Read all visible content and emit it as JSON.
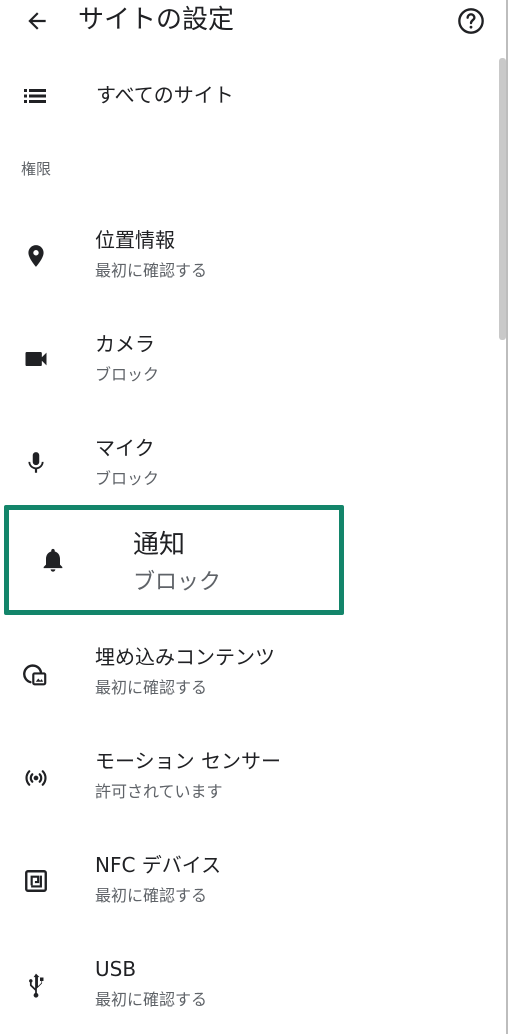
{
  "header": {
    "title": "サイトの設定",
    "back_icon": "arrow-back-icon",
    "help_icon": "help-circle-icon"
  },
  "all_sites": {
    "label": "すべてのサイト",
    "icon": "list-icon"
  },
  "section": {
    "label": "権限"
  },
  "items": [
    {
      "title": "位置情報",
      "subtitle": "最初に確認する",
      "icon": "location-pin-icon"
    },
    {
      "title": "カメラ",
      "subtitle": "ブロック",
      "icon": "videocam-icon"
    },
    {
      "title": "マイク",
      "subtitle": "ブロック",
      "icon": "mic-icon"
    },
    {
      "title": "通知",
      "subtitle": "ブロック",
      "icon": "bell-icon"
    },
    {
      "title": "埋め込みコンテンツ",
      "subtitle": "最初に確認する",
      "icon": "embedded-content-icon"
    },
    {
      "title": "モーション センサー",
      "subtitle": "許可されています",
      "icon": "sensors-icon"
    },
    {
      "title": "NFC デバイス",
      "subtitle": "最初に確認する",
      "icon": "nfc-icon"
    },
    {
      "title": "USB",
      "subtitle": "最初に確認する",
      "icon": "usb-icon"
    }
  ],
  "colors": {
    "highlight_border": "#13856a",
    "text_primary": "#202124",
    "text_secondary": "#5f6368"
  }
}
